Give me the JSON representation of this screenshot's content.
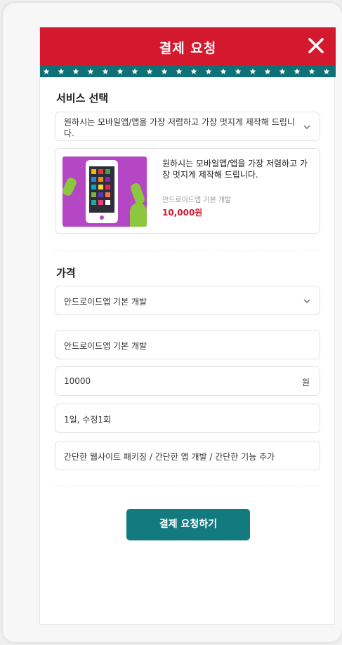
{
  "modal": {
    "title": "결제 요청",
    "close_icon": "close-icon"
  },
  "service_section": {
    "title": "서비스 선택",
    "select_value": "원하시는 모바일앱/앱을 가장 저렴하고 가장 멋지게 제작해 드립니다.",
    "product": {
      "description": "원하시는 모바일앱/앱을 가장 저렴하고 가장 멋지게 제작해 드립니다.",
      "option_name": "안드로이드앱 기본 개발",
      "price": "10,000원",
      "image_icon": "android-app-image"
    }
  },
  "price_section": {
    "title": "가격",
    "option_select_value": "안드로이드앱 기본 개발",
    "option_name_value": "안드로이드앱 기본 개발",
    "amount_value": "10000",
    "amount_unit": "원",
    "period_value": "1일, 수정1회",
    "scope_value": "간단한 웹사이트 패키징 / 간단한 앱 개발 / 간단한 기능 추가"
  },
  "submit_label": "결제 요청하기",
  "colors": {
    "header": "#d4192f",
    "star_band": "#0e7178",
    "button": "#137a80",
    "price": "#d4192f"
  }
}
